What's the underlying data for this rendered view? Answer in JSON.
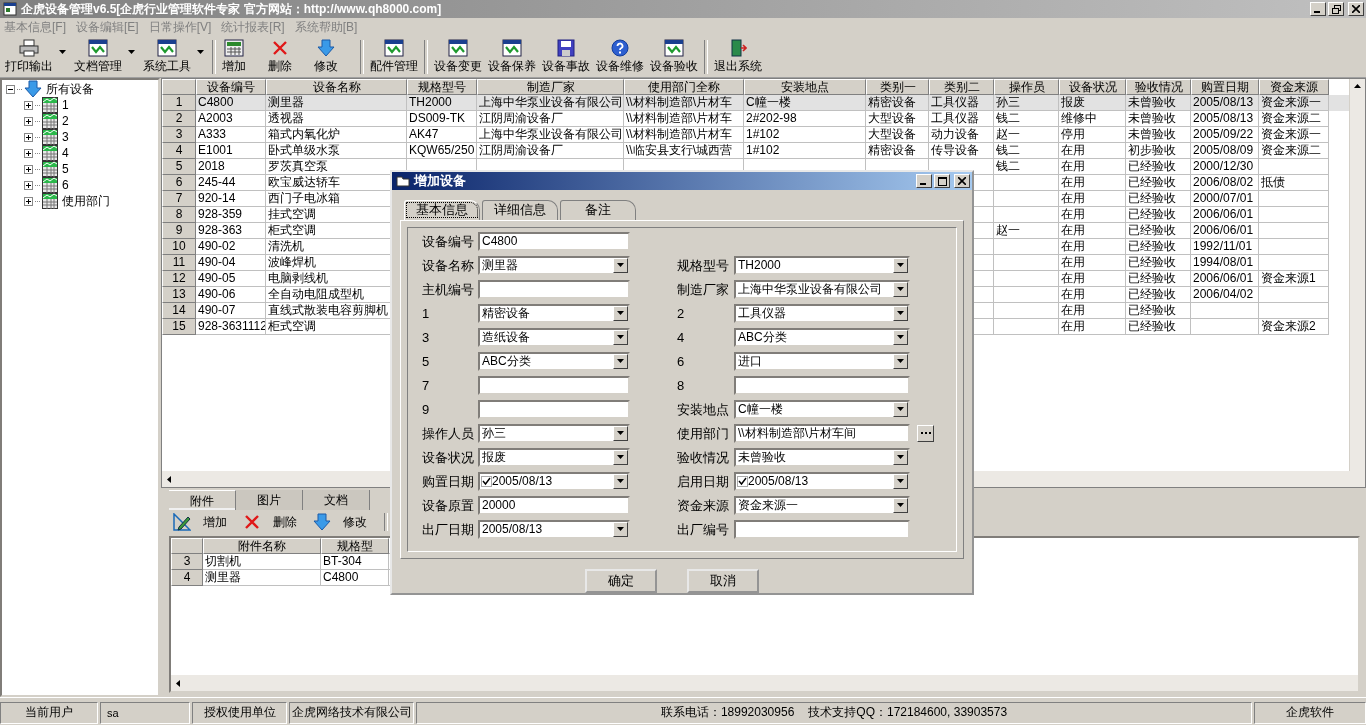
{
  "window": {
    "title": "企虎设备管理v6.5[企虎行业管理软件专家 官方网站：http://www.qh8000.com]"
  },
  "menu": [
    "基本信息[F]",
    "设备编辑[E]",
    "日常操作[V]",
    "统计报表[R]",
    "系统帮助[B]"
  ],
  "toolbar": [
    [
      {
        "label": "打印输出",
        "dropdown": true
      },
      {
        "label": "文档管理",
        "dropdown": true
      },
      {
        "label": "系统工具",
        "dropdown": true
      }
    ],
    [
      {
        "label": "增加",
        "dropdown": false
      },
      {
        "label": "删除",
        "dropdown": false
      },
      {
        "label": "修改",
        "dropdown": false
      }
    ],
    [
      {
        "label": "配件管理",
        "dropdown": false
      }
    ],
    [
      {
        "label": "设备变更",
        "dropdown": false
      },
      {
        "label": "设备保养",
        "dropdown": false
      },
      {
        "label": "设备事故",
        "dropdown": false
      },
      {
        "label": "设备维修",
        "dropdown": false
      },
      {
        "label": "设备验收",
        "dropdown": false
      }
    ],
    [
      {
        "label": "退出系统",
        "dropdown": false
      }
    ]
  ],
  "tree": [
    {
      "label": "所有设备",
      "expanded": true,
      "children": [
        {
          "label": "1",
          "expanded": false
        },
        {
          "label": "2",
          "expanded": false
        },
        {
          "label": "3",
          "expanded": false
        },
        {
          "label": "4",
          "expanded": false
        },
        {
          "label": "5",
          "expanded": false
        },
        {
          "label": "6",
          "expanded": false
        },
        {
          "label": "使用部门",
          "expanded": false
        }
      ]
    }
  ],
  "table": {
    "columns": [
      "设备编号",
      "设备名称",
      "规格型号",
      "制造厂家",
      "使用部门全称",
      "安装地点",
      "类别一",
      "类别二",
      "操作员",
      "设备状况",
      "验收情况",
      "购置日期",
      "资金来源"
    ],
    "rows": [
      {
        "no": "1",
        "selected": true,
        "cells": [
          "C4800",
          "测里器",
          "TH2000",
          "上海中华泵业设备有限公司",
          "\\\\材料制造部\\片材车",
          "C幢一楼",
          "精密设备",
          "工具仪器",
          "孙三",
          "报废",
          "未曾验收",
          "2005/08/13",
          "资金来源一"
        ]
      },
      {
        "no": "2",
        "selected": false,
        "cells": [
          "A2003",
          "透视器",
          "DS009-TK",
          "江阴周渝设备厂",
          "\\\\材料制造部\\片材车",
          "2#202-98",
          "大型设备",
          "工具仪器",
          "钱二",
          "维修中",
          "未曾验收",
          "2005/08/13",
          "资金来源二"
        ]
      },
      {
        "no": "3",
        "selected": false,
        "cells": [
          "A333",
          "箱式内氧化炉",
          "AK47",
          "上海中华泵业设备有限公司",
          "\\\\材料制造部\\片材车",
          "1#102",
          "大型设备",
          "动力设备",
          "赵一",
          "停用",
          "未曾验收",
          "2005/09/22",
          "资金来源一"
        ]
      },
      {
        "no": "4",
        "selected": false,
        "cells": [
          "E1001",
          "卧式单级水泵",
          "KQW65/250",
          "江阴周渝设备厂",
          "\\\\临安县支行\\城西营",
          "1#102",
          "精密设备",
          "传导设备",
          "钱二",
          "在用",
          "初步验收",
          "2005/08/09",
          "资金来源二"
        ]
      },
      {
        "no": "5",
        "selected": false,
        "cells": [
          "2018",
          "罗茨真空泵",
          null,
          null,
          null,
          null,
          null,
          null,
          "钱二",
          "在用",
          "已经验收",
          "2000/12/30",
          null
        ]
      },
      {
        "no": "6",
        "selected": false,
        "cells": [
          "245-44",
          "欧宝威达轿车",
          null,
          null,
          null,
          null,
          null,
          null,
          null,
          "在用",
          "已经验收",
          "2006/08/02",
          "抵债"
        ]
      },
      {
        "no": "7",
        "selected": false,
        "cells": [
          "920-14",
          "西门子电冰箱",
          null,
          null,
          null,
          null,
          null,
          null,
          null,
          "在用",
          "已经验收",
          "2000/07/01",
          null
        ]
      },
      {
        "no": "8",
        "selected": false,
        "cells": [
          "928-359",
          "挂式空调",
          null,
          null,
          null,
          null,
          null,
          null,
          null,
          "在用",
          "已经验收",
          "2006/06/01",
          null
        ]
      },
      {
        "no": "9",
        "selected": false,
        "cells": [
          "928-363",
          "柜式空调",
          null,
          null,
          null,
          null,
          null,
          null,
          "赵一",
          "在用",
          "已经验收",
          "2006/06/01",
          null
        ]
      },
      {
        "no": "10",
        "selected": false,
        "cells": [
          "490-02",
          "清洗机",
          null,
          null,
          null,
          null,
          null,
          null,
          null,
          "在用",
          "已经验收",
          "1992/11/01",
          null
        ]
      },
      {
        "no": "11",
        "selected": false,
        "cells": [
          "490-04",
          "波峰焊机",
          null,
          null,
          null,
          null,
          null,
          null,
          null,
          "在用",
          "已经验收",
          "1994/08/01",
          null
        ]
      },
      {
        "no": "12",
        "selected": false,
        "cells": [
          "490-05",
          "电脑剥线机",
          null,
          null,
          null,
          null,
          null,
          null,
          null,
          "在用",
          "已经验收",
          "2006/06/01",
          "资金来源1"
        ]
      },
      {
        "no": "13",
        "selected": false,
        "cells": [
          "490-06",
          "全自动电阻成型机",
          null,
          null,
          null,
          null,
          null,
          null,
          null,
          "在用",
          "已经验收",
          "2006/04/02",
          null
        ]
      },
      {
        "no": "14",
        "selected": false,
        "cells": [
          "490-07",
          "直线式散装电容剪脚机",
          null,
          null,
          null,
          null,
          null,
          null,
          null,
          "在用",
          "已经验收",
          null,
          null
        ]
      },
      {
        "no": "15",
        "selected": false,
        "cells": [
          "928-3631112",
          "柜式空调",
          null,
          null,
          null,
          null,
          null,
          null,
          null,
          "在用",
          "已经验收",
          null,
          "资金来源2"
        ]
      }
    ]
  },
  "attachments": {
    "tabs": [
      {
        "label": "附件",
        "selected": true
      },
      {
        "label": "图片",
        "selected": false
      },
      {
        "label": "文档",
        "selected": false
      }
    ],
    "toolbar": [
      {
        "label": "增加"
      },
      {
        "label": "删除"
      },
      {
        "label": "修改"
      }
    ],
    "columns": [
      "附件名称",
      "规格型"
    ],
    "rows": [
      {
        "no": "3",
        "cells": [
          "切割机",
          "BT-304"
        ]
      },
      {
        "no": "4",
        "cells": [
          "测里器",
          "C4800"
        ]
      }
    ]
  },
  "dialog": {
    "title": "增加设备",
    "tabs": [
      {
        "label": "基本信息",
        "selected": true
      },
      {
        "label": "详细信息",
        "selected": false
      },
      {
        "label": "备注",
        "selected": false
      }
    ],
    "rows": [
      {
        "left": {
          "label": "设备编号",
          "kind": "text",
          "value": "C4800"
        },
        "right": null
      },
      {
        "left": {
          "label": "设备名称",
          "kind": "combo",
          "value": "测里器"
        },
        "right": {
          "label": "规格型号",
          "kind": "combo",
          "value": "TH2000"
        }
      },
      {
        "left": {
          "label": "主机编号",
          "kind": "text"
        },
        "right": {
          "label": "制造厂家",
          "kind": "combo",
          "value": "上海中华泵业设备有限公司"
        }
      },
      {
        "left": {
          "label": "1",
          "kind": "combo",
          "value": "精密设备"
        },
        "right": {
          "label": "2",
          "kind": "combo",
          "value": "工具仪器"
        }
      },
      {
        "left": {
          "label": "3",
          "kind": "combo",
          "value": "造纸设备"
        },
        "right": {
          "label": "4",
          "kind": "combo",
          "value": "ABC分类"
        }
      },
      {
        "left": {
          "label": "5",
          "kind": "combo",
          "value": "ABC分类"
        },
        "right": {
          "label": "6",
          "kind": "combo",
          "value": "进口"
        }
      },
      {
        "left": {
          "label": "7",
          "kind": "text"
        },
        "right": {
          "label": "8",
          "kind": "text"
        }
      },
      {
        "left": {
          "label": "9",
          "kind": "text"
        },
        "right": {
          "label": "安装地点",
          "kind": "combo",
          "value": "C幢一楼"
        }
      },
      {
        "left": {
          "label": "操作人员",
          "kind": "combo",
          "value": "孙三"
        },
        "right": {
          "label": "使用部门",
          "kind": "browse",
          "value": "\\\\材料制造部\\片材车间"
        }
      },
      {
        "left": {
          "label": "设备状况",
          "kind": "combo",
          "value": "报废"
        },
        "right": {
          "label": "验收情况",
          "kind": "combo",
          "value": "未曾验收"
        }
      },
      {
        "left": {
          "label": "购置日期",
          "kind": "date",
          "checked": true,
          "value": "2005/08/13"
        },
        "right": {
          "label": "启用日期",
          "kind": "date",
          "checked": true,
          "value": "2005/08/13"
        }
      },
      {
        "left": {
          "label": "设备原置",
          "kind": "text",
          "value": "20000"
        },
        "right": {
          "label": "资金来源",
          "kind": "combo",
          "value": "资金来源一"
        }
      },
      {
        "left": {
          "label": "出厂日期",
          "kind": "combo",
          "value": "2005/08/13"
        },
        "right": {
          "label": "出厂编号",
          "kind": "text"
        }
      }
    ],
    "buttons": [
      "确定",
      "取消"
    ]
  },
  "status_bar": [
    {
      "texts": [
        "当前用户"
      ]
    },
    {
      "texts": [
        "sa"
      ]
    },
    {
      "texts": [
        "授权使用单位"
      ]
    },
    {
      "texts": [
        "企虎网络技术有限公司"
      ]
    },
    {
      "texts": [
        "联系电话：18992030956",
        "技术支持QQ：172184600, 33903573"
      ]
    },
    {
      "texts": [
        "企虎软件"
      ]
    }
  ]
}
